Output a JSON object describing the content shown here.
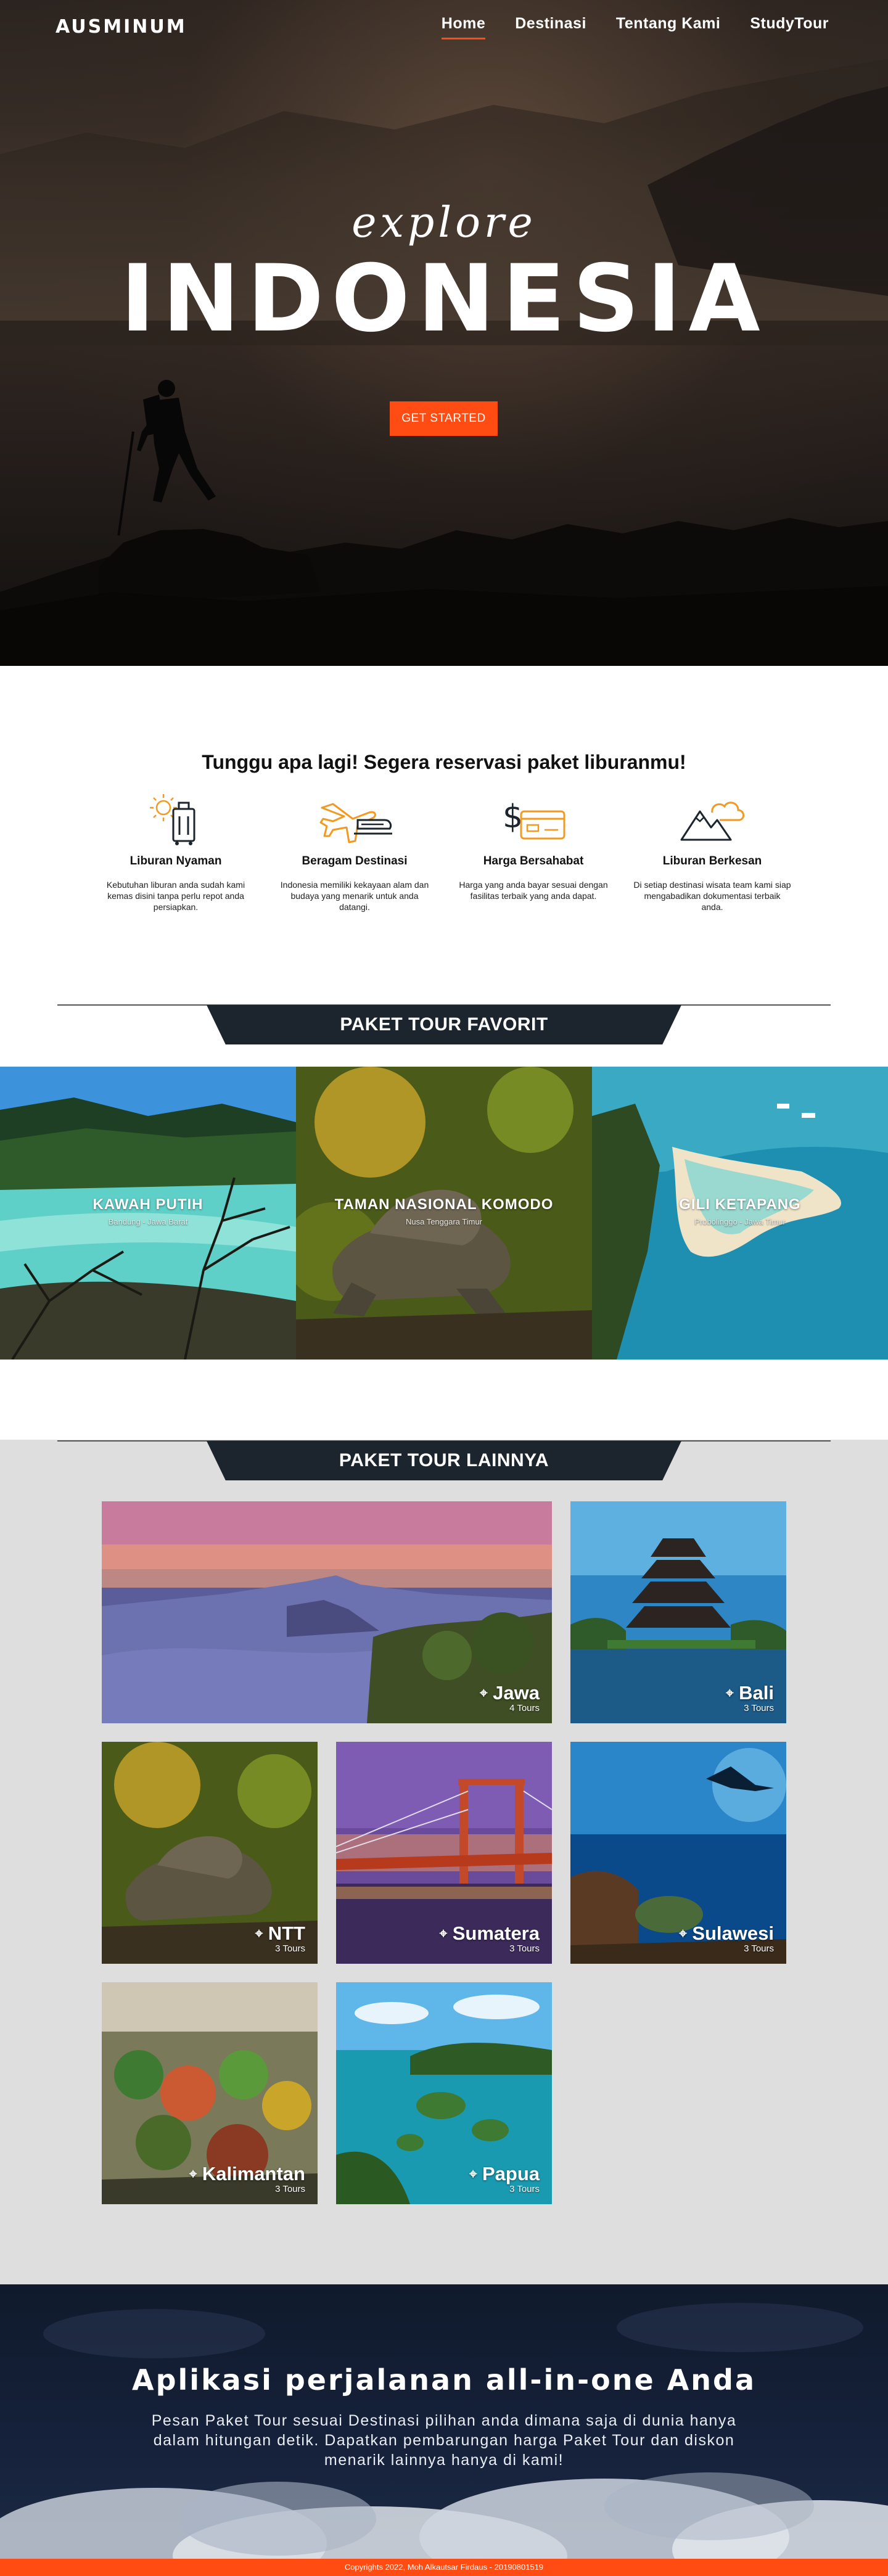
{
  "brand": {
    "name": "AUSMINUM"
  },
  "nav": {
    "items": [
      {
        "label": "Home",
        "active": true
      },
      {
        "label": "Destinasi",
        "active": false
      },
      {
        "label": "Tentang Kami",
        "active": false
      },
      {
        "label": "StudyTour",
        "active": false
      }
    ]
  },
  "hero": {
    "script_text": "explore",
    "headline": "INDONESIA",
    "cta_label": "GET STARTED"
  },
  "features": {
    "title": "Tunggu apa lagi! Segera reservasi paket liburanmu!",
    "items": [
      {
        "icon": "luggage-sun-icon",
        "title": "Liburan Nyaman",
        "text": "Kebutuhan liburan anda sudah kami kemas disini tanpa perlu repot anda persiapkan."
      },
      {
        "icon": "plane-train-icon",
        "title": "Beragam Destinasi",
        "text": "Indonesia memiliki kekayaan alam dan budaya yang menarik untuk anda datangi."
      },
      {
        "icon": "money-card-icon",
        "title": "Harga Bersahabat",
        "text": "Harga yang anda bayar sesuai dengan fasilitas terbaik yang anda dapat."
      },
      {
        "icon": "mountain-cloud-icon",
        "title": "Liburan Berkesan",
        "text": "Di setiap destinasi wisata team kami siap mengabadikan dokumentasi terbaik anda."
      }
    ]
  },
  "favorit": {
    "title": "PAKET TOUR FAVORIT",
    "items": [
      {
        "name": "KAWAH PUTIH",
        "sub": "Bandung - Jawa Barat"
      },
      {
        "name": "TAMAN NASIONAL KOMODO",
        "sub": "Nusa Tenggara Timur"
      },
      {
        "name": "GILI KETAPANG",
        "sub": "Probolinggo - Jawa Timur"
      }
    ]
  },
  "lainnya": {
    "title": "PAKET TOUR LAINNYA",
    "items": [
      {
        "name": "Jawa",
        "count": "4 Tours"
      },
      {
        "name": "Bali",
        "count": "3 Tours"
      },
      {
        "name": "NTT",
        "count": "3 Tours"
      },
      {
        "name": "Sumatera",
        "count": "3 Tours"
      },
      {
        "name": "Sulawesi",
        "count": "3 Tours"
      },
      {
        "name": "Kalimantan",
        "count": "3 Tours"
      },
      {
        "name": "Papua",
        "count": "3 Tours"
      }
    ]
  },
  "app_banner": {
    "title": "Aplikasi perjalanan all-in-one Anda",
    "description": "Pesan Paket Tour sesuai Destinasi pilihan anda dimana saja di dunia hanya dalam hitungan detik. Dapatkan pembarungan harga Paket Tour dan diskon menarik lainnya hanya di kami!"
  },
  "footer": {
    "text": "Copyrights 2022, Moh Alkautsar Firdaus - 20190801519"
  },
  "colors": {
    "accent": "#ff4c12",
    "banner": "#1c252d",
    "section_bg": "#dedede",
    "app_bg": "#15213a"
  }
}
